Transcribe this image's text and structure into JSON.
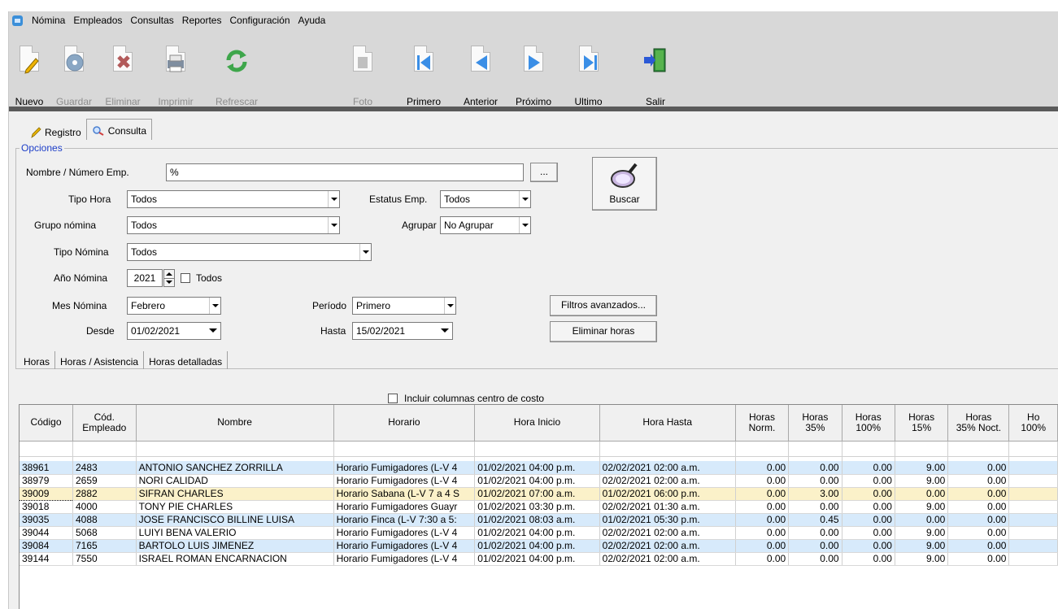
{
  "menu": [
    "Nómina",
    "Empleados",
    "Consultas",
    "Reportes",
    "Configuración",
    "Ayuda"
  ],
  "toolbar": [
    {
      "label": "Nuevo",
      "icon": "new-document-icon",
      "enabled": true
    },
    {
      "label": "Guardar",
      "icon": "save-disc-icon",
      "enabled": false
    },
    {
      "label": "Eliminar",
      "icon": "delete-document-icon",
      "enabled": false
    },
    {
      "label": "Imprimir",
      "icon": "printer-icon",
      "enabled": false
    },
    {
      "label": "Refrescar",
      "icon": "refresh-icon",
      "enabled": false
    },
    {
      "label": "Foto",
      "icon": "photo-icon",
      "enabled": false
    },
    {
      "label": "Primero",
      "icon": "first-record-icon",
      "enabled": true
    },
    {
      "label": "Anterior",
      "icon": "previous-record-icon",
      "enabled": true
    },
    {
      "label": "Próximo",
      "icon": "next-record-icon",
      "enabled": true
    },
    {
      "label": "Ultimo",
      "icon": "last-record-icon",
      "enabled": true
    },
    {
      "label": "Salir",
      "icon": "exit-door-icon",
      "enabled": true
    }
  ],
  "tabs_top": [
    {
      "label": "Registro",
      "icon": "pencil-icon",
      "active": false
    },
    {
      "label": "Consulta",
      "icon": "search-icon",
      "active": true
    }
  ],
  "opciones": {
    "legend": "Opciones",
    "nombre_label": "Nombre / Número Emp.",
    "nombre_value": "%",
    "ellipsis_label": "...",
    "tipo_hora_label": "Tipo Hora",
    "tipo_hora_value": "Todos",
    "grupo_nomina_label": "Grupo nómina",
    "grupo_nomina_value": "Todos",
    "tipo_nomina_label": "Tipo Nómina",
    "tipo_nomina_value": "Todos",
    "anio_label": "Año Nómina",
    "anio_value": "2021",
    "todos_check_label": "Todos",
    "mes_label": "Mes Nómina",
    "mes_value": "Febrero",
    "desde_label": "Desde",
    "desde_value": "01/02/2021",
    "estatus_label": "Estatus Emp.",
    "estatus_value": "Todos",
    "agrupar_label": "Agrupar",
    "agrupar_value": "No Agrupar",
    "periodo_label": "Período",
    "periodo_value": "Primero",
    "hasta_label": "Hasta",
    "hasta_value": "15/02/2021",
    "buscar_label": "Buscar",
    "filtros_label": "Filtros avanzados...",
    "eliminar_horas_label": "Eliminar horas"
  },
  "tabs_bottom": [
    {
      "label": "Horas",
      "active": true
    },
    {
      "label": "Horas / Asistencia",
      "active": false
    },
    {
      "label": "Horas detalladas",
      "active": false
    }
  ],
  "incluir_label": "Incluir columnas centro de costo",
  "grid": {
    "columns": [
      "Código",
      "Cód.\nEmpleado",
      "Nombre",
      "Horario",
      "Hora Inicio",
      "Hora Hasta",
      "Horas\nNorm.",
      "Horas\n35%",
      "Horas\n100%",
      "Horas\n15%",
      "Horas\n35% Noct.",
      "Ho\n100%"
    ],
    "rows": [
      [
        "38961",
        "2483",
        "ANTONIO SANCHEZ ZORRILLA",
        "Horario Fumigadores (L-V 4",
        "01/02/2021 04:00 p.m.",
        "02/02/2021 02:00 a.m.",
        "0.00",
        "0.00",
        "0.00",
        "9.00",
        "0.00",
        ""
      ],
      [
        "38979",
        "2659",
        "NORI CALIDAD",
        "Horario Fumigadores (L-V 4",
        "01/02/2021 04:00 p.m.",
        "02/02/2021 02:00 a.m.",
        "0.00",
        "0.00",
        "0.00",
        "9.00",
        "0.00",
        ""
      ],
      [
        "39009",
        "2882",
        "SIFRAN CHARLES",
        "Horario Sabana (L-V 7 a 4 S",
        "01/02/2021 07:00 a.m.",
        "01/02/2021 06:00 p.m.",
        "0.00",
        "3.00",
        "0.00",
        "0.00",
        "0.00",
        ""
      ],
      [
        "39018",
        "4000",
        "TONY PIE CHARLES",
        "Horario Fumigadores Guayr",
        "01/02/2021 03:30 p.m.",
        "02/02/2021 01:30 a.m.",
        "0.00",
        "0.00",
        "0.00",
        "9.00",
        "0.00",
        ""
      ],
      [
        "39035",
        "4088",
        "JOSE FRANCISCO BILLINE LUISA",
        "Horario Finca (L-V 7:30 a 5:",
        "01/02/2021 08:03 a.m.",
        "01/02/2021 05:30 p.m.",
        "0.00",
        "0.45",
        "0.00",
        "0.00",
        "0.00",
        ""
      ],
      [
        "39044",
        "5068",
        "LUIYI BENA VALERIO",
        "Horario Fumigadores (L-V 4",
        "01/02/2021 04:00 p.m.",
        "02/02/2021 02:00 a.m.",
        "0.00",
        "0.00",
        "0.00",
        "9.00",
        "0.00",
        ""
      ],
      [
        "39084",
        "7165",
        "BARTOLO LUIS JIMENEZ",
        "Horario Fumigadores (L-V 4",
        "01/02/2021 04:00 p.m.",
        "02/02/2021 02:00 a.m.",
        "0.00",
        "0.00",
        "0.00",
        "9.00",
        "0.00",
        ""
      ],
      [
        "39144",
        "7550",
        "ISRAEL ROMAN ENCARNACION",
        "Horario Fumigadores (L-V 4",
        "01/02/2021 04:00 p.m.",
        "02/02/2021 02:00 a.m.",
        "0.00",
        "0.00",
        "0.00",
        "9.00",
        "0.00",
        ""
      ]
    ]
  },
  "colors": {
    "alt_row": "#d7eafb",
    "selected_row": "#fbf1c9",
    "legend": "#1d3ec8"
  }
}
